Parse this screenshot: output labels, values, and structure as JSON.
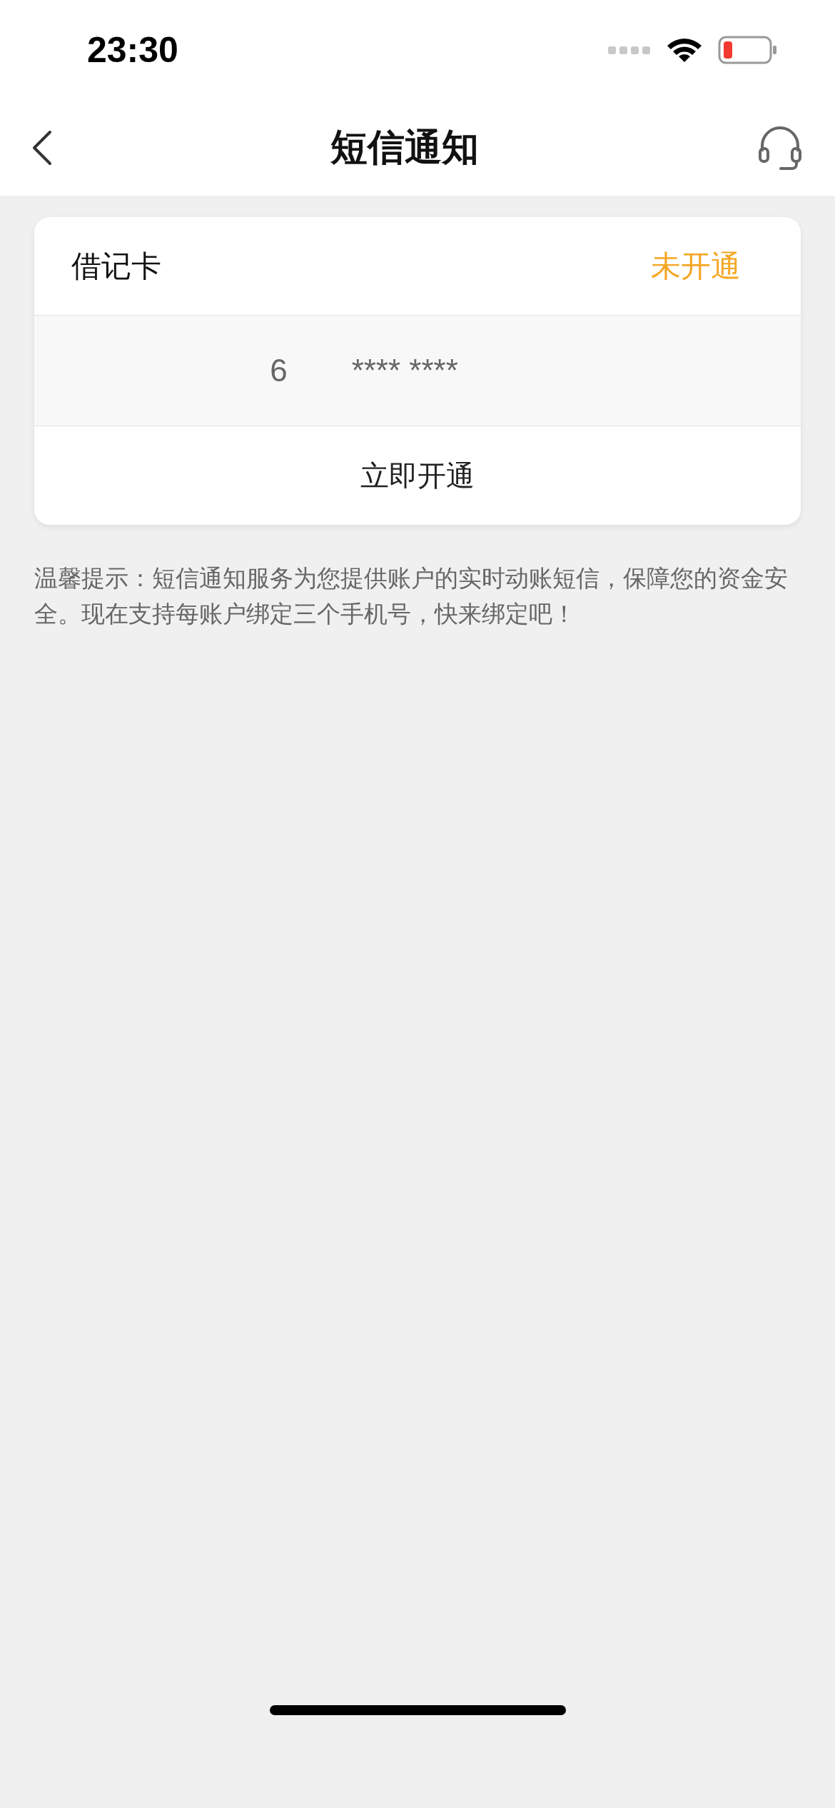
{
  "status_bar": {
    "time": "23:30"
  },
  "nav_bar": {
    "title": "短信通知"
  },
  "card": {
    "type_label": "借记卡",
    "status": "未开通",
    "activated": false,
    "card_number": [
      "6",
      "**** ****"
    ],
    "action": "立即开通"
  },
  "tip": "温馨提示：短信通知服务为您提供账户的实时动账短信，保障您的资金安全。现在支持每账户绑定三个手机号，快来绑定吧！"
}
